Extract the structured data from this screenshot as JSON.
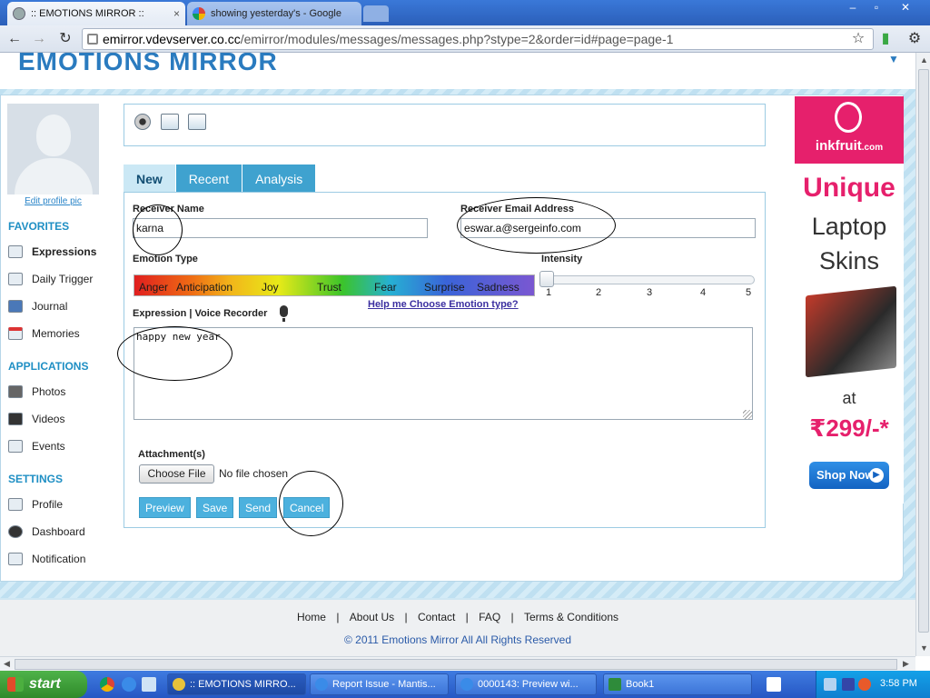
{
  "browser": {
    "tabs": [
      {
        "label": ":: EMOTIONS MIRROR ::",
        "close": "×"
      },
      {
        "label": "showing yesterday's - Google"
      }
    ],
    "url_host": "emirror.vdevserver.co.cc",
    "url_path": "/emirror/modules/messages/messages.php?stype=2&order=id#page=page-1",
    "window_controls": [
      "–",
      "▫",
      "✕"
    ]
  },
  "header": {
    "logo_text": "EMOTIONS MIRROR"
  },
  "sidebar": {
    "edit_profile_pic": "Edit profile pic",
    "favorites_heading": "FAVORITES",
    "favorites": [
      {
        "label": "Expressions"
      },
      {
        "label": "Daily Trigger"
      },
      {
        "label": "Journal"
      },
      {
        "label": "Memories"
      }
    ],
    "applications_heading": "APPLICATIONS",
    "applications": [
      {
        "label": "Photos"
      },
      {
        "label": "Videos"
      },
      {
        "label": "Events"
      }
    ],
    "settings_heading": "SETTINGS",
    "settings": [
      {
        "label": "Profile"
      },
      {
        "label": "Dashboard"
      },
      {
        "label": "Notification"
      }
    ]
  },
  "form_tabs": [
    {
      "label": "New"
    },
    {
      "label": "Recent"
    },
    {
      "label": "Analysis"
    }
  ],
  "form": {
    "receiver_name_label": "Receiver Name",
    "receiver_name_value": "karna",
    "receiver_email_label": "Receiver Email Address",
    "receiver_email_value": "eswar.a@sergeinfo.com",
    "emotion_type_label": "Emotion Type",
    "emotions": [
      "Anger",
      "Anticipation",
      "Joy",
      "Trust",
      "Fear",
      "Surprise",
      "Sadness"
    ],
    "help_link": "Help me Choose Emotion type?",
    "intensity_label": "Intensity",
    "intensity_scale": [
      "1",
      "2",
      "3",
      "4",
      "5"
    ],
    "intensity_value": 1,
    "expression_label": "Expression | Voice Recorder",
    "expression_value": "happy new year",
    "attachments_label": "Attachment(s)",
    "choose_file": "Choose File",
    "file_status": "No file chosen",
    "buttons": {
      "preview": "Preview",
      "save": "Save",
      "send": "Send",
      "cancel": "Cancel"
    }
  },
  "ad": {
    "brand": "inkfruit",
    "brand_suffix": ".com",
    "line1": "Unique",
    "line2": "Laptop",
    "line3": "Skins",
    "at": "at",
    "price": "₹299/-*",
    "cta": "Shop Now"
  },
  "footer": {
    "links": [
      "Home",
      "About Us",
      "Contact",
      "FAQ",
      "Terms & Conditions"
    ],
    "separator": "|",
    "copyright": "© 2011 Emotions Mirror All All Rights Reserved"
  },
  "taskbar": {
    "start": "start",
    "items": [
      {
        "label": ":: EMOTIONS MIRRO...",
        "icon_color": "#e8c23a"
      },
      {
        "label": "Report Issue - Mantis...",
        "icon_color": "#3a8be8"
      },
      {
        "label": "0000143: Preview wi...",
        "icon_color": "#3a8be8"
      },
      {
        "label": "Book1",
        "icon_color": "#2e8b3a"
      }
    ],
    "clock": "3:58 PM"
  },
  "colors": {
    "accent_blue": "#3fa2cf",
    "sidebar_heading": "#1f8fc4",
    "ad_pink": "#e6206c"
  }
}
